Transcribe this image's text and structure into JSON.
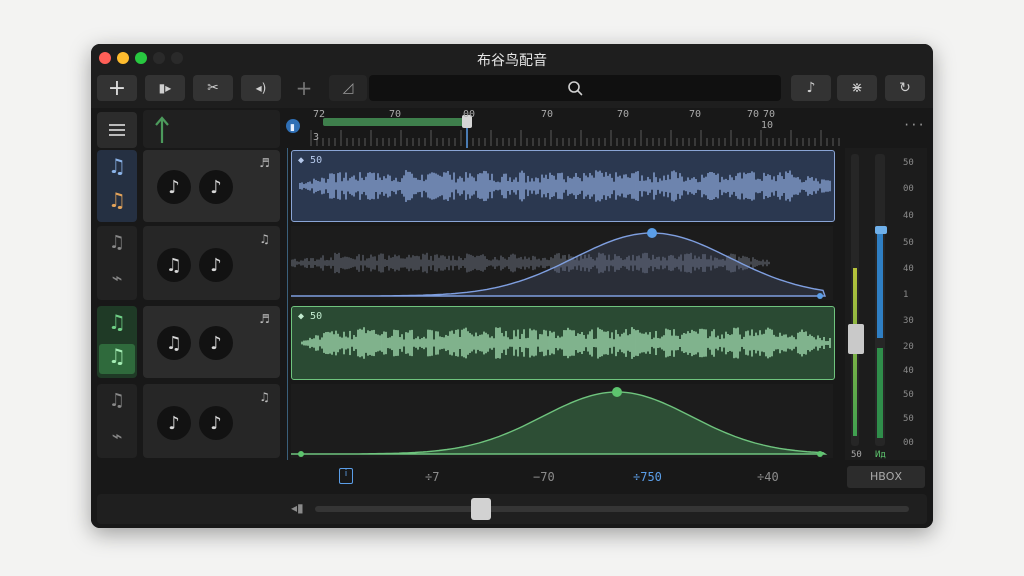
{
  "window": {
    "title": "布谷鸟配音"
  },
  "toolbar": {
    "add_label": "+",
    "split_label": "▮▸",
    "cut_label": "✂",
    "volume_label": "◂)",
    "add2_label": "+",
    "fade_label": "◿",
    "note_label": "♪",
    "effects_label": "⋇",
    "loop_label": "↻"
  },
  "ruler": {
    "labels": [
      "72",
      "70",
      "00",
      "70",
      "70",
      "70",
      "70",
      "70",
      "10"
    ],
    "start_label": "3",
    "more_label": "···",
    "progress": 0.5
  },
  "tracks": [
    {
      "clip_label": "50",
      "color": "#8aa5d6"
    },
    {
      "clip_label": "",
      "color": "#7f9fe0"
    },
    {
      "clip_label": "50",
      "color": "#a6e0b4"
    },
    {
      "clip_label": "",
      "color": "#6fc47e"
    }
  ],
  "bottom_ruler": {
    "labels": [
      "÷7",
      "−70",
      "÷750",
      "÷40"
    ]
  },
  "meter": {
    "labels": [
      "50",
      "00",
      "40",
      "50",
      "40",
      "1",
      "30",
      "20",
      "40",
      "50",
      "50",
      "00"
    ],
    "left_value": "50",
    "right_value": "Ид",
    "button_label": "НВОХ"
  },
  "colors": {
    "blue": "#8aa5d6",
    "green": "#6fc47e",
    "accent": "#5b9ee8"
  }
}
